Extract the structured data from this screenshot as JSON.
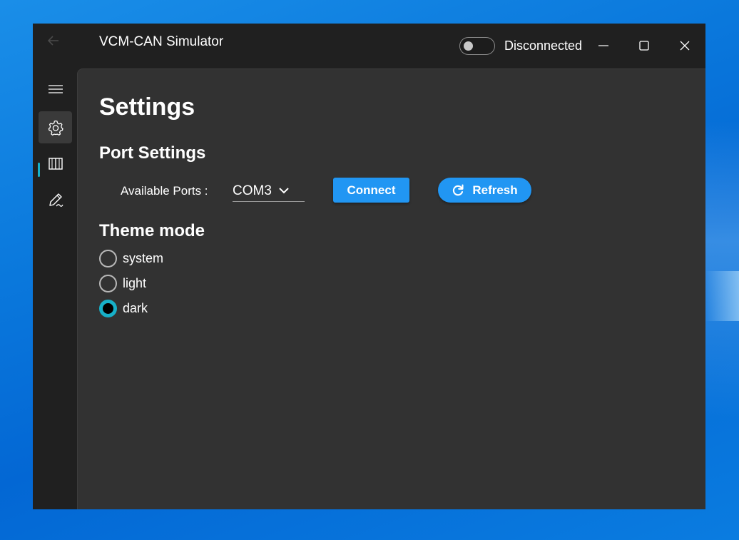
{
  "window": {
    "title": "VCM-CAN Simulator",
    "connection_toggle": {
      "on": false
    },
    "connection_status": "Disconnected",
    "controls": [
      "minimize-icon",
      "maximize-icon",
      "close-icon"
    ]
  },
  "sidebar": {
    "items": [
      {
        "name": "menu",
        "icon": "hamburger-icon",
        "active": false
      },
      {
        "name": "settings",
        "icon": "gear-icon",
        "active": true
      },
      {
        "name": "book",
        "icon": "book-icon",
        "active": false
      },
      {
        "name": "edit",
        "icon": "pencil-icon",
        "active": false
      }
    ],
    "accent_color": "#17b0c8"
  },
  "main": {
    "page_title": "Settings",
    "port_settings": {
      "heading": "Port Settings",
      "ports_label": "Available Ports :",
      "selected_port": "COM3",
      "connect_label": "Connect",
      "refresh_label": "Refresh",
      "button_color": "#2196f3"
    },
    "theme": {
      "heading": "Theme mode",
      "options": [
        {
          "label": "system",
          "checked": false
        },
        {
          "label": "light",
          "checked": false
        },
        {
          "label": "dark",
          "checked": true
        }
      ]
    }
  }
}
